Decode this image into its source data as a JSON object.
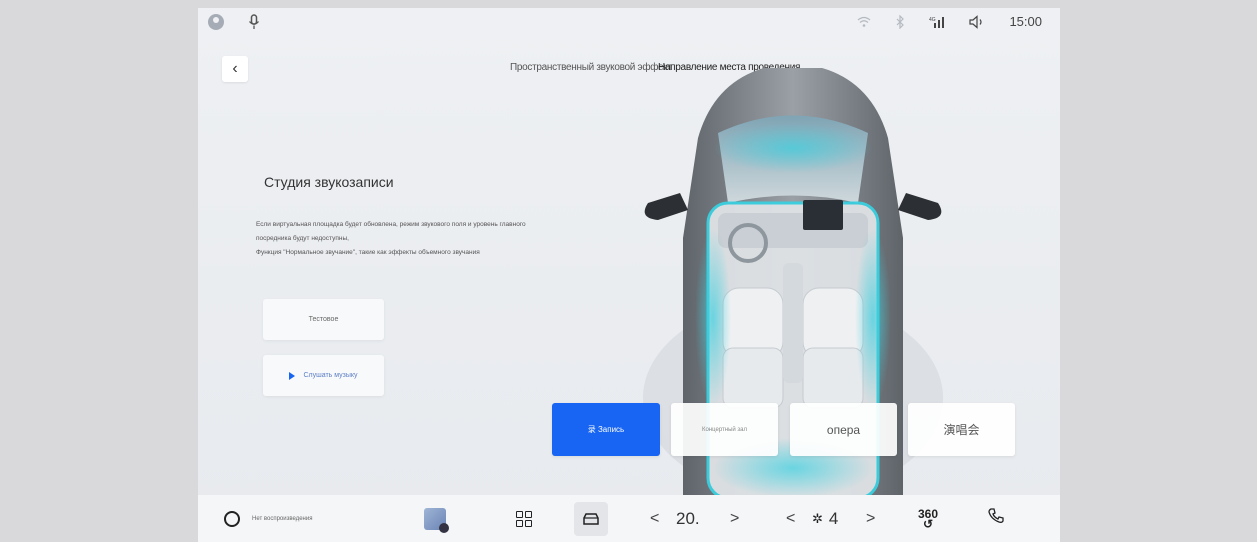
{
  "status_bar": {
    "left_icons": [
      "user-icon",
      "microphone-icon"
    ],
    "right_icons": [
      "wifi-icon",
      "bluetooth-icon",
      "signal-icon",
      "volume-icon"
    ],
    "clock": "15:00"
  },
  "header": {
    "back_icon": "chevron-left-icon",
    "tabs": [
      {
        "label": "Пространственный звуковой эффект"
      },
      {
        "label": "Направление места проведения"
      }
    ]
  },
  "studio": {
    "title": "Студия звукозаписи",
    "description_line1": "Если виртуальная площадка будет обновлена, режим звукового поля и уровень главного посредника будут недоступны,",
    "description_line2": "Функция \"Нормальное звучание\", такие как эффекты объемного звучания"
  },
  "side_buttons": {
    "top_label": "Тестовое",
    "listen_label": "Слушать музыку"
  },
  "modes": [
    {
      "label": "录 Запись",
      "active": true
    },
    {
      "label": "Концертный зал"
    },
    {
      "label": "опера"
    },
    {
      "label": "演唱会"
    }
  ],
  "dock": {
    "music_label": "Нет воспроизведения",
    "temperature": "20.",
    "fan_level": "4",
    "view_360_label": "360"
  },
  "colors": {
    "accent": "#1765f2",
    "background": "#eef0f3",
    "dock_bg": "#f5f6f8"
  }
}
